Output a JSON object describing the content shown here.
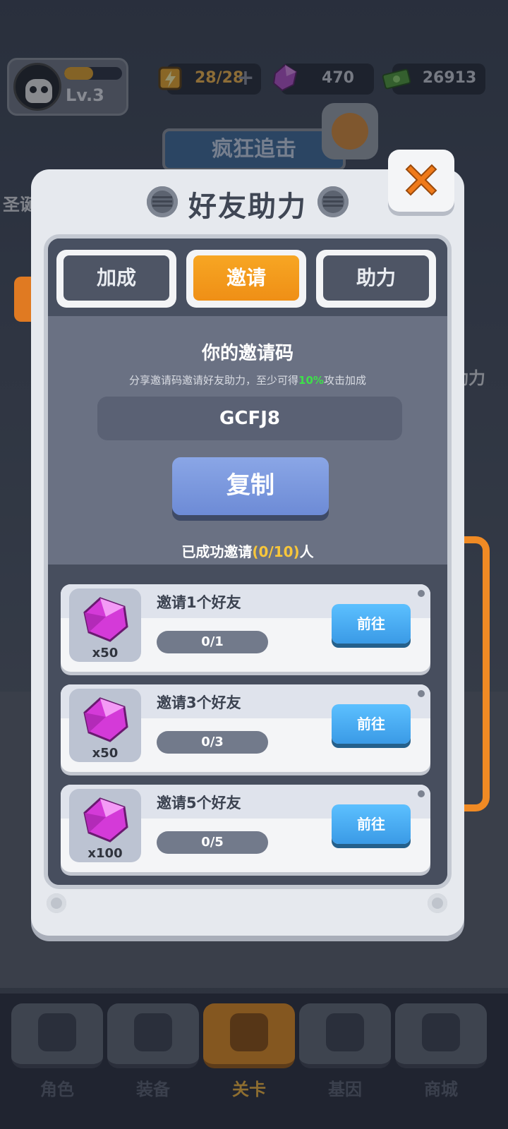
{
  "hud": {
    "level": "Lv.3",
    "xp_fraction": 0.5,
    "energy": "28/28",
    "gems": "470",
    "cash": "26913",
    "plus": "+"
  },
  "background": {
    "mode_banner": "疯狂追击",
    "left_label": "圣诞",
    "right_label": "助力"
  },
  "modal": {
    "title": "好友助力",
    "tabs": [
      {
        "label": "加成",
        "active": false
      },
      {
        "label": "邀请",
        "active": true
      },
      {
        "label": "助力",
        "active": false
      }
    ],
    "invite": {
      "heading": "你的邀请码",
      "subtitle_prefix": "分享邀请码邀请好友助力，至少可得",
      "subtitle_highlight": "10%",
      "subtitle_suffix": "攻击加成",
      "code": "GCFJ8",
      "copy_label": "复制",
      "count_prefix": "已成功邀请",
      "count_value": "(0/10)",
      "count_suffix": "人"
    },
    "tasks": [
      {
        "title": "邀请1个好友",
        "progress": "0/1",
        "reward_qty": "x50",
        "button": "前往"
      },
      {
        "title": "邀请3个好友",
        "progress": "0/3",
        "reward_qty": "x50",
        "button": "前往"
      },
      {
        "title": "邀请5个好友",
        "progress": "0/5",
        "reward_qty": "x100",
        "button": "前往"
      }
    ]
  },
  "bottom_nav": [
    {
      "label": "角色",
      "icon": "skull-icon",
      "active": false
    },
    {
      "label": "装备",
      "icon": "gun-icon",
      "active": false
    },
    {
      "label": "关卡",
      "icon": "map-pin-icon",
      "active": true
    },
    {
      "label": "基因",
      "icon": "lock-icon",
      "active": false
    },
    {
      "label": "商城",
      "icon": "shop-icon",
      "active": false
    }
  ],
  "colors": {
    "accent_orange": "#f7a623",
    "highlight_green": "#3ee04a",
    "highlight_yellow": "#f7c63b",
    "gem_pink": "#d43ad8",
    "button_blue": "#3a9ae6"
  }
}
